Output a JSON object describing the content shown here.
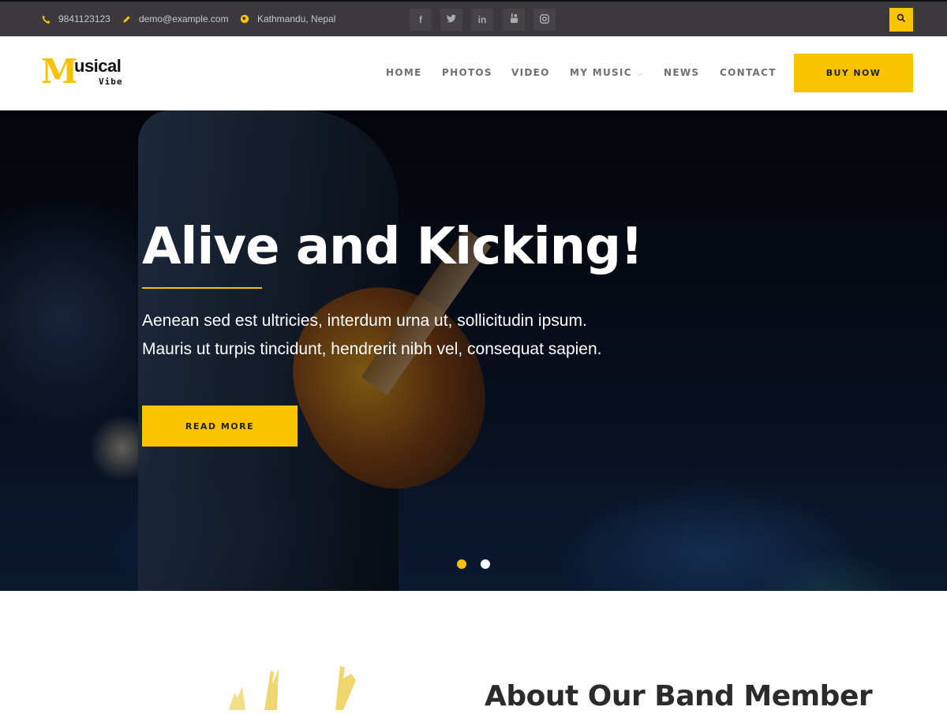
{
  "topbar": {
    "phone": "9841123123",
    "email": "demo@example.com",
    "location": "Kathmandu, Nepal",
    "icons": {
      "phone": "phone-icon",
      "email": "pencil-icon",
      "location": "map-pin-icon"
    },
    "social": [
      {
        "name": "facebook",
        "glyph": "f"
      },
      {
        "name": "twitter",
        "glyph": "t"
      },
      {
        "name": "linkedin",
        "glyph": "in"
      },
      {
        "name": "youtube",
        "glyph": "▶"
      },
      {
        "name": "instagram",
        "glyph": "◎"
      }
    ],
    "search_icon": "search-icon"
  },
  "header": {
    "logo": {
      "initial": "M",
      "word": "usical",
      "sub": "Vibe"
    },
    "nav": [
      {
        "label": "HOME"
      },
      {
        "label": "PHOTOS"
      },
      {
        "label": "VIDEO"
      },
      {
        "label": "MY MUSIC",
        "dropdown": true
      },
      {
        "label": "NEWS"
      },
      {
        "label": "CONTACT"
      }
    ],
    "cta_label": "BUY NOW"
  },
  "hero": {
    "title": "Alive and Kicking!",
    "text_line1": "Aenean sed est ultricies, interdum urna ut, sollicitudin ipsum.",
    "text_line2": "Mauris ut turpis tincidunt, hendrerit nibh vel, consequat sapien.",
    "button_label": "READ MORE",
    "slides": {
      "count": 2,
      "active": 1
    }
  },
  "about": {
    "title": "About Our Band Member"
  },
  "colors": {
    "accent": "#fcc300",
    "topbar_bg": "#3b393d",
    "nav_text": "#6f6f6f",
    "heading": "#2b2b2b"
  }
}
